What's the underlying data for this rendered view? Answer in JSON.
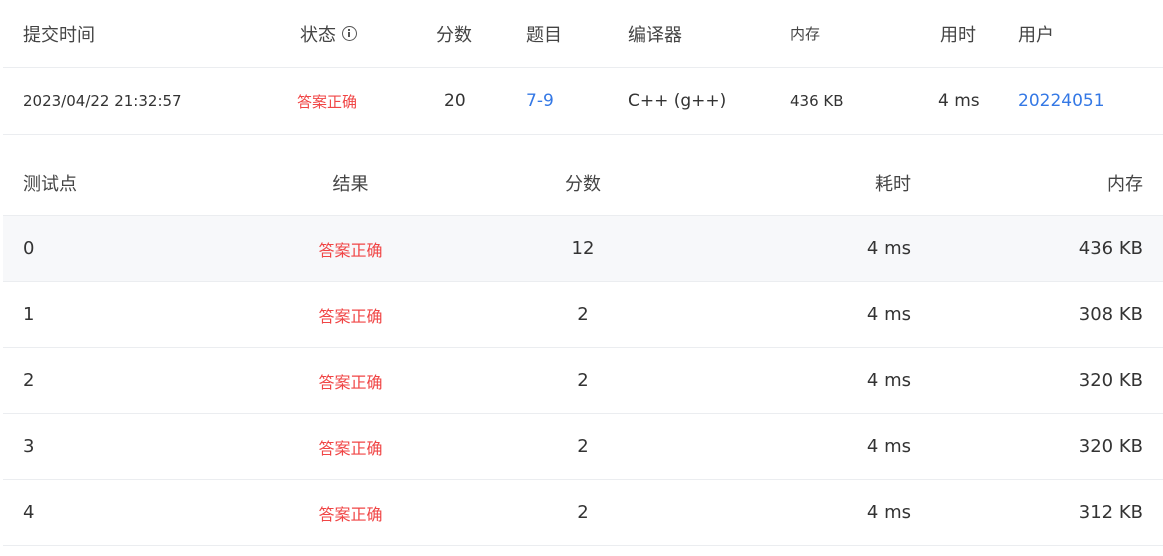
{
  "summary": {
    "headers": {
      "submit_time": "提交时间",
      "status": "状态",
      "score": "分数",
      "problem": "题目",
      "compiler": "编译器",
      "memory": "内存",
      "time": "用时",
      "user": "用户"
    },
    "row": {
      "submit_time": "2023/04/22 21:32:57",
      "status": "答案正确",
      "score": "20",
      "problem": "7-9",
      "compiler": "C++ (g++)",
      "memory": "436 KB",
      "time": "4 ms",
      "user": "20224051"
    }
  },
  "cases": {
    "headers": {
      "case": "测试点",
      "result": "结果",
      "score": "分数",
      "time": "耗时",
      "memory": "内存"
    },
    "rows": [
      {
        "case": "0",
        "result": "答案正确",
        "score": "12",
        "time": "4 ms",
        "memory": "436 KB"
      },
      {
        "case": "1",
        "result": "答案正确",
        "score": "2",
        "time": "4 ms",
        "memory": "308 KB"
      },
      {
        "case": "2",
        "result": "答案正确",
        "score": "2",
        "time": "4 ms",
        "memory": "320 KB"
      },
      {
        "case": "3",
        "result": "答案正确",
        "score": "2",
        "time": "4 ms",
        "memory": "320 KB"
      },
      {
        "case": "4",
        "result": "答案正确",
        "score": "2",
        "time": "4 ms",
        "memory": "312 KB"
      }
    ]
  },
  "colors": {
    "accepted": "#f04545",
    "link": "#3478e5",
    "row_shade": "#f7f8fa",
    "divider": "#ebedf0"
  }
}
